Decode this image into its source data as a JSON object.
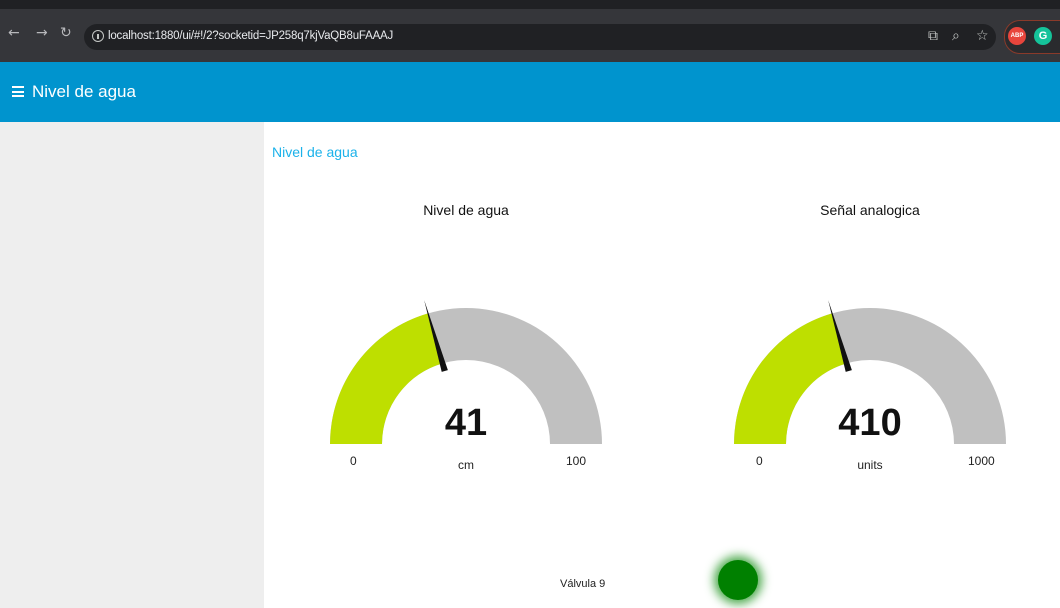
{
  "browser": {
    "url": "localhost:1880/ui/#!/2?socketid=JP258q7kjVaQB8uFAAAJ",
    "icons": [
      "back-arrow-icon",
      "forward-arrow-icon",
      "reload-icon",
      "info-icon",
      "install-icon",
      "zoom-icon",
      "bookmark-star-icon",
      "adblock-icon",
      "grammarly-icon"
    ],
    "adblock_label": "ABP",
    "grammarly_label": "G"
  },
  "toolbar": {
    "title": "Nivel de agua",
    "color": "#0094ce"
  },
  "group": {
    "title": "Nivel de agua"
  },
  "gauges": [
    {
      "title": "Nivel de agua",
      "value": "41",
      "units": "cm",
      "min": "0",
      "max": "100",
      "fraction": 0.41,
      "fill_color": "#bedf00",
      "track_color": "#c0c0c0"
    },
    {
      "title": "Señal analogica",
      "value": "410",
      "units": "units",
      "min": "0",
      "max": "1000",
      "fraction": 0.41,
      "fill_color": "#bedf00",
      "track_color": "#c0c0c0"
    }
  ],
  "led": {
    "label": "Válvula 9",
    "color": "#008000"
  }
}
